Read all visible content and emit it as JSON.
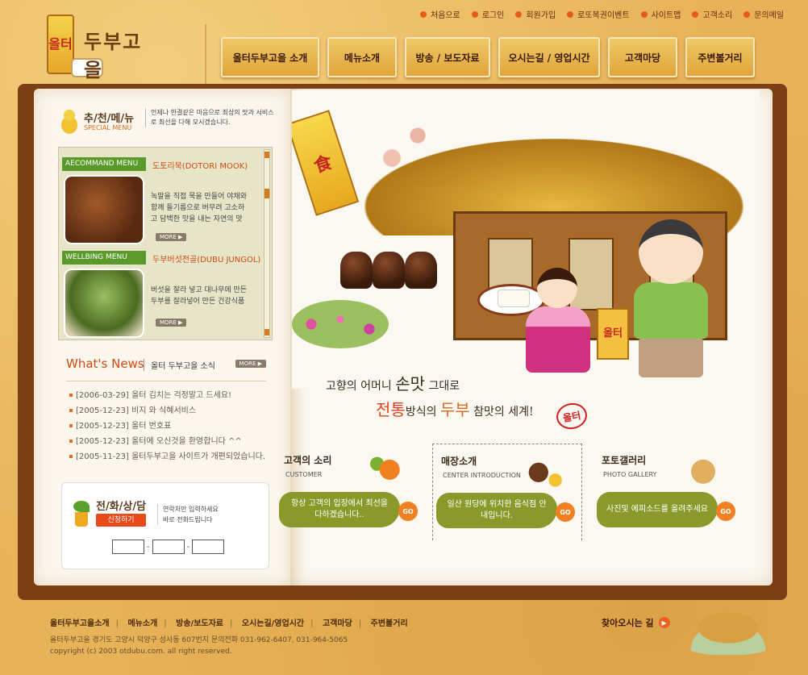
{
  "logo": {
    "banner_text": "올터",
    "name": "두부고을"
  },
  "topmenu": [
    "처음으로",
    "로그인",
    "회원가입",
    "로또복권이벤트",
    "사이트맵",
    "고객소리",
    "문의메일"
  ],
  "gnb": [
    "올터두부고을 소개",
    "메뉴소개",
    "방송 / 보도자료",
    "오시는길 / 영업시간",
    "고객마당",
    "주변볼거리"
  ],
  "special": {
    "title": "추/천/메/뉴",
    "subtitle": "SPECIAL MENU",
    "desc": "언제나 한결같은 마음으로 최상의 맛과 서비스로 최선을 다해 모시겠습니다."
  },
  "menus": [
    {
      "tag": "AECOMMAND MENU",
      "name": "도토리묵(DOTORI MOOK)",
      "desc": "녹말을 직접 묵을 만들어 야채와 함께 들기름으로 버무려 고소하고 담백한 맛을 내는 자연의 맛",
      "more": "MORE ▶"
    },
    {
      "tag": "WELLBING MENU",
      "name": "두부버섯전골(DUBU JUNGOL)",
      "desc": "버섯을 잘라 넣고 대나무에 만든 두부를 잘라넣어 만든 건강식품",
      "more": "MORE ▶"
    }
  ],
  "news": {
    "title_en": "What's News",
    "title_kr": "올터 두부고을 소식",
    "more": "MORE ▶",
    "items": [
      "[2006-03-29] 올터 김치는 걱정말고 드세요!",
      "[2005-12-23] 비지 와 식혜서비스",
      "[2005-12-23] 올터 번호표",
      "[2005-12-23] 올터에 오신것을 환영합니다 ^^",
      "[2005-11-23] 올터두부고을 사이트가 개편되었습니다."
    ]
  },
  "phone": {
    "title": "전/화/상/담",
    "button": "신청하기",
    "desc_line1": "연락처만 입력하세요",
    "desc_line2": "바로 전화드립니다"
  },
  "scene": {
    "lantern": "食",
    "bag": "올터"
  },
  "slogan": {
    "l1a": "고향의 어머니 ",
    "l1b": "손맛",
    "l1c": " 그대로",
    "l2a": "전통",
    "l2b": "방식의 ",
    "l2c": "두부",
    "l2d": " 참맛의 세계!",
    "seal": "올터"
  },
  "cards": [
    {
      "title": "고객의 소리",
      "en": "CUSTOMER",
      "text": "항상 고객의 입장에서 최선을 다하겠습니다..",
      "go": "GO"
    },
    {
      "title": "매장소개",
      "en": "CENTER   INTRODUCTION",
      "text": "일산 원당에 위치한 음식점 안내입니다.",
      "go": "GO"
    },
    {
      "title": "포토갤러리",
      "en": "PHOTO GALLERY",
      "text": "사진및 에피소드를 올려주세요",
      "go": "GO"
    }
  ],
  "footer": {
    "menu": [
      "올터두부고을소개",
      "메뉴소개",
      "방송/보도자료",
      "오시는길/영업시간",
      "고객마당",
      "주변볼거리"
    ],
    "address": "올터두부고을  경기도 고양시 덕양구 성사동 607번지   문의전화 031-962-6407, 031-964-5065",
    "copyright": "copyright (c) 2003 otdubu.com. all right reserved.",
    "find": "찾아오시는 길"
  },
  "colors": {
    "accent": "#e85a1a",
    "green": "#5a9a2a",
    "brown": "#7b3e15"
  }
}
